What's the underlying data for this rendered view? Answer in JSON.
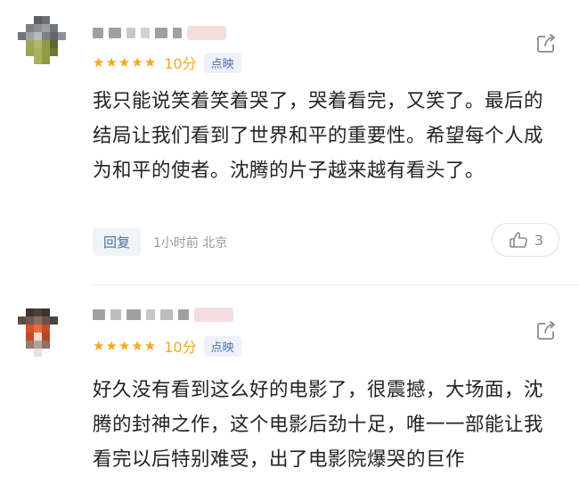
{
  "comments": [
    {
      "rating_stars": "★★★★★",
      "score": "10分",
      "source_tag": "点映",
      "text": "我只能说笑着笑着哭了，哭着看完，又笑了。最后的结局让我们看到了世界和平的重要性。希望每个人成为和平的使者。沈腾的片子越来越有看头了。",
      "reply_label": "回复",
      "time_location": "1小时前 北京",
      "like_count": "3"
    },
    {
      "rating_stars": "★★★★★",
      "score": "10分",
      "source_tag": "点映",
      "text": "好久没有看到这么好的电影了，很震撼，大场面，沈腾的封神之作，这个电影后劲十足，唯一一部能让我看完以后特别难受，出了电影院爆哭的巨作"
    }
  ],
  "colors": {
    "star": "#f5a623",
    "tag_text": "#4a6fa5",
    "tag_bg": "#eef2f8"
  },
  "icons": [
    "share-icon",
    "thumbs-up-icon"
  ]
}
